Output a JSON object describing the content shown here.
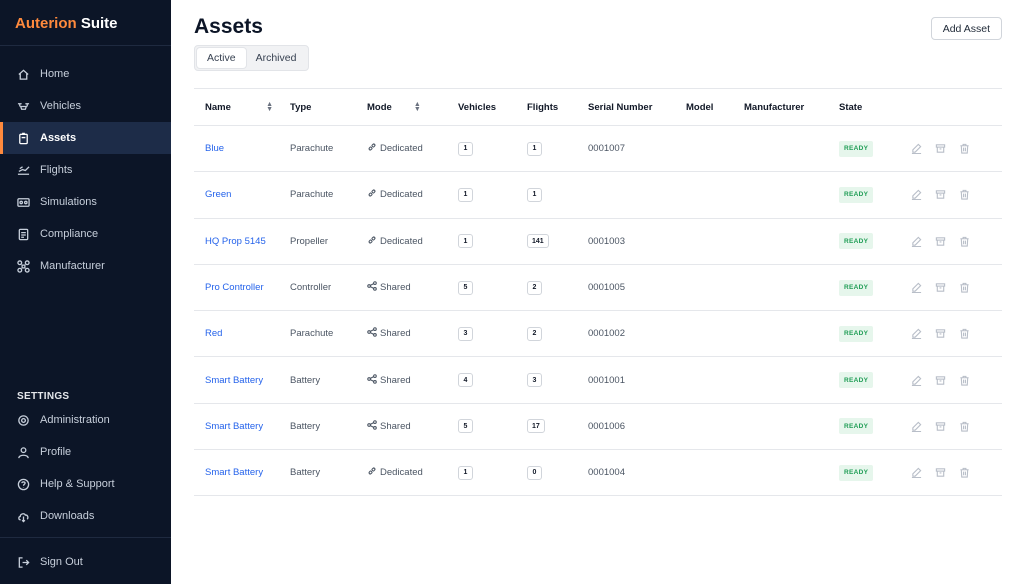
{
  "brand": {
    "part1": "Auterion",
    "part2": " Suite"
  },
  "nav": {
    "items": [
      {
        "label": "Home"
      },
      {
        "label": "Vehicles"
      },
      {
        "label": "Assets"
      },
      {
        "label": "Flights"
      },
      {
        "label": "Simulations"
      },
      {
        "label": "Compliance"
      },
      {
        "label": "Manufacturer"
      }
    ],
    "active_index": 2
  },
  "settings": {
    "heading": "SETTINGS",
    "items": [
      {
        "label": "Administration"
      },
      {
        "label": "Profile"
      },
      {
        "label": "Help & Support"
      },
      {
        "label": "Downloads"
      }
    ],
    "signout": "Sign Out"
  },
  "page": {
    "title": "Assets",
    "add_button": "Add Asset"
  },
  "tabs": [
    {
      "label": "Active"
    },
    {
      "label": "Archived"
    }
  ],
  "table": {
    "headers": [
      "Name",
      "Type",
      "Mode",
      "Vehicles",
      "Flights",
      "Serial Number",
      "Model",
      "Manufacturer",
      "State"
    ],
    "rows": [
      {
        "name": "Blue",
        "type": "Parachute",
        "mode": "Dedicated",
        "vehicles": "1",
        "flights": "1",
        "serial": "0001007",
        "model": "",
        "manufacturer": "",
        "state": "READY"
      },
      {
        "name": "Green",
        "type": "Parachute",
        "mode": "Dedicated",
        "vehicles": "1",
        "flights": "1",
        "serial": "",
        "model": "",
        "manufacturer": "",
        "state": "READY"
      },
      {
        "name": "HQ Prop 5145",
        "type": "Propeller",
        "mode": "Dedicated",
        "vehicles": "1",
        "flights": "141",
        "serial": "0001003",
        "model": "",
        "manufacturer": "",
        "state": "READY"
      },
      {
        "name": "Pro Controller",
        "type": "Controller",
        "mode": "Shared",
        "vehicles": "5",
        "flights": "2",
        "serial": "0001005",
        "model": "",
        "manufacturer": "",
        "state": "READY"
      },
      {
        "name": "Red",
        "type": "Parachute",
        "mode": "Shared",
        "vehicles": "3",
        "flights": "2",
        "serial": "0001002",
        "model": "",
        "manufacturer": "",
        "state": "READY"
      },
      {
        "name": "Smart Battery",
        "type": "Battery",
        "mode": "Shared",
        "vehicles": "4",
        "flights": "3",
        "serial": "0001001",
        "model": "",
        "manufacturer": "",
        "state": "READY"
      },
      {
        "name": "Smart Battery",
        "type": "Battery",
        "mode": "Shared",
        "vehicles": "5",
        "flights": "17",
        "serial": "0001006",
        "model": "",
        "manufacturer": "",
        "state": "READY"
      },
      {
        "name": "Smart Battery",
        "type": "Battery",
        "mode": "Dedicated",
        "vehicles": "1",
        "flights": "0",
        "serial": "0001004",
        "model": "",
        "manufacturer": "",
        "state": "READY"
      }
    ]
  },
  "colors": {
    "sidebar": "#0c1527",
    "accent": "#ff8a3d",
    "link": "#2563eb",
    "ready_bg": "#e6f6ec",
    "ready_text": "#1f9d55"
  }
}
